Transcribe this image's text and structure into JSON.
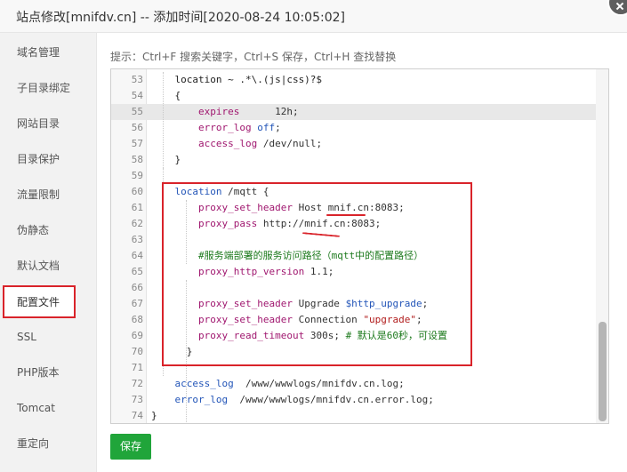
{
  "window": {
    "title": "站点修改[mnifdv.cn] -- 添加时间[2020-08-24 10:05:02]"
  },
  "sidebar": {
    "items": [
      {
        "label": "域名管理"
      },
      {
        "label": "子目录绑定"
      },
      {
        "label": "网站目录"
      },
      {
        "label": "目录保护"
      },
      {
        "label": "流量限制"
      },
      {
        "label": "伪静态"
      },
      {
        "label": "默认文档"
      },
      {
        "label": "配置文件",
        "active": true
      },
      {
        "label": "SSL"
      },
      {
        "label": "PHP版本"
      },
      {
        "label": "Tomcat"
      },
      {
        "label": "重定向"
      }
    ]
  },
  "editor": {
    "hint": "提示：Ctrl+F 搜索关键字，Ctrl+S 保存，Ctrl+H 查找替换",
    "lines": [
      {
        "n": "53",
        "tokens": [
          [
            "    location ~ .*\\.(js|css)?$",
            "kw"
          ]
        ]
      },
      {
        "n": "54",
        "tokens": [
          [
            "    {",
            "kw"
          ]
        ]
      },
      {
        "n": "55",
        "highlight": true,
        "tokens": [
          [
            "        ",
            "kw"
          ],
          [
            "expires",
            "dir"
          ],
          [
            "      12h;",
            "val"
          ]
        ]
      },
      {
        "n": "56",
        "tokens": [
          [
            "        ",
            "kw"
          ],
          [
            "error_log",
            "dir"
          ],
          [
            " ",
            "val"
          ],
          [
            "off",
            "var"
          ],
          [
            ";",
            "val"
          ]
        ]
      },
      {
        "n": "57",
        "tokens": [
          [
            "        ",
            "kw"
          ],
          [
            "access_log",
            "dir"
          ],
          [
            " /dev/null;",
            "val"
          ]
        ]
      },
      {
        "n": "58",
        "tokens": [
          [
            "    }",
            "kw"
          ]
        ]
      },
      {
        "n": "59",
        "tokens": []
      },
      {
        "n": "60",
        "tokens": [
          [
            "    ",
            "kw"
          ],
          [
            "location",
            "var"
          ],
          [
            " /mqtt {",
            "val"
          ]
        ]
      },
      {
        "n": "61",
        "tokens": [
          [
            "        ",
            "kw"
          ],
          [
            "proxy_set_header",
            "dir"
          ],
          [
            " Host mnif.cn:8083;",
            "val"
          ]
        ]
      },
      {
        "n": "62",
        "tokens": [
          [
            "        ",
            "kw"
          ],
          [
            "proxy_pass",
            "dir"
          ],
          [
            " http://mnif.cn:8083;",
            "val"
          ]
        ]
      },
      {
        "n": "63",
        "tokens": []
      },
      {
        "n": "64",
        "tokens": [
          [
            "        ",
            "kw"
          ],
          [
            "#服务端部署的服务访问路径（mqtt中的配置路径）",
            "cmt"
          ]
        ]
      },
      {
        "n": "65",
        "tokens": [
          [
            "        ",
            "kw"
          ],
          [
            "proxy_http_version",
            "dir"
          ],
          [
            " 1.1;",
            "val"
          ]
        ]
      },
      {
        "n": "66",
        "tokens": []
      },
      {
        "n": "67",
        "tokens": [
          [
            "        ",
            "kw"
          ],
          [
            "proxy_set_header",
            "dir"
          ],
          [
            " Upgrade ",
            "val"
          ],
          [
            "$http_upgrade",
            "var"
          ],
          [
            ";",
            "val"
          ]
        ]
      },
      {
        "n": "68",
        "tokens": [
          [
            "        ",
            "kw"
          ],
          [
            "proxy_set_header",
            "dir"
          ],
          [
            " Connection ",
            "val"
          ],
          [
            "\"upgrade\"",
            "str"
          ],
          [
            ";",
            "val"
          ]
        ]
      },
      {
        "n": "69",
        "tokens": [
          [
            "        ",
            "kw"
          ],
          [
            "proxy_read_timeout",
            "dir"
          ],
          [
            " 300s; ",
            "val"
          ],
          [
            "# 默认是60秒，可设置",
            "cmt"
          ]
        ]
      },
      {
        "n": "70",
        "tokens": [
          [
            "      }",
            "kw"
          ]
        ]
      },
      {
        "n": "71",
        "tokens": []
      },
      {
        "n": "72",
        "tokens": [
          [
            "    ",
            "kw"
          ],
          [
            "access_log",
            "var"
          ],
          [
            "  /www/wwwlogs/mnifdv.cn.log;",
            "val"
          ]
        ]
      },
      {
        "n": "73",
        "tokens": [
          [
            "    ",
            "kw"
          ],
          [
            "error_log",
            "var"
          ],
          [
            "  /www/wwwlogs/mnifdv.cn.error.log;",
            "val"
          ]
        ]
      },
      {
        "n": "74",
        "tokens": [
          [
            "}",
            "kw"
          ]
        ]
      }
    ]
  },
  "footer": {
    "save_label": "保存"
  },
  "colors": {
    "accent": "#20a53a",
    "annotation": "#d9232a"
  }
}
